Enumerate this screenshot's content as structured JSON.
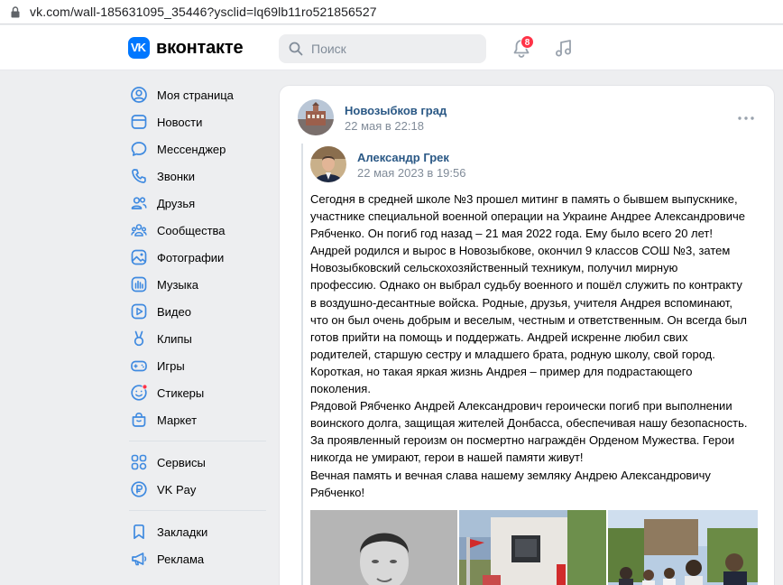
{
  "browser": {
    "url": "vk.com/wall-185631095_35446?ysclid=lq69lb11ro521856527"
  },
  "header": {
    "logo_mark": "VK",
    "logo_text": "вконтакте",
    "search_placeholder": "Поиск",
    "notifications_count": "8",
    "brand_color": "#0077ff",
    "icons": [
      "search-icon",
      "bell-icon",
      "music-icon"
    ]
  },
  "sidebar": {
    "items": [
      {
        "label": "Моя страница",
        "icon": "user-circle-icon"
      },
      {
        "label": "Новости",
        "icon": "news-icon"
      },
      {
        "label": "Мессенджер",
        "icon": "message-icon"
      },
      {
        "label": "Звонки",
        "icon": "phone-icon"
      },
      {
        "label": "Друзья",
        "icon": "friends-icon"
      },
      {
        "label": "Сообщества",
        "icon": "communities-icon"
      },
      {
        "label": "Фотографии",
        "icon": "photo-icon"
      },
      {
        "label": "Музыка",
        "icon": "music-icon"
      },
      {
        "label": "Видео",
        "icon": "video-icon"
      },
      {
        "label": "Клипы",
        "icon": "clips-icon"
      },
      {
        "label": "Игры",
        "icon": "gamepad-icon"
      },
      {
        "label": "Стикеры",
        "icon": "sticker-icon"
      },
      {
        "label": "Маркет",
        "icon": "market-icon"
      }
    ],
    "items2": [
      {
        "label": "Сервисы",
        "icon": "services-icon"
      },
      {
        "label": "VK Pay",
        "icon": "vkpay-icon"
      }
    ],
    "items3": [
      {
        "label": "Закладки",
        "icon": "bookmark-icon"
      },
      {
        "label": "Реклама",
        "icon": "megaphone-icon"
      }
    ]
  },
  "post": {
    "author": "Новозыбков град",
    "date": "22 мая в 22:18",
    "repost": {
      "author": "Александр Грек",
      "date": "22 мая 2023 в 19:56",
      "text_lines": [
        "Сегодня в средней школе №3 прошел митинг в память о бывшем выпускнике,",
        "участнике специальной военной операции на Украине Андрее Александровиче",
        "Рябченко. Он погиб год назад – 21 мая 2022 года. Ему было всего 20 лет!",
        "Андрей родился и вырос в Новозыбкове, окончил 9 классов СОШ №3, затем",
        "Новозыбковский сельскохозяйственный техникум, получил мирную",
        "профессию. Однако он выбрал судьбу военного и пошёл служить по контракту",
        "в воздушно-десантные войска. Родные, друзья, учителя Андрея вспоминают,",
        "что он был очень добрым и веселым, честным и ответственным. Он всегда был",
        "готов прийти на помощь и поддержать. Андрей искренне любил свих",
        "родителей, старшую сестру и младшего брата, родную школу, свой город.",
        "Короткая, но такая яркая жизнь Андрея – пример для подрастающего",
        "поколения.",
        "Рядовой Рябченко Андрей Александрович героически погиб при выполнении",
        "воинского долга, защищая жителей Донбасса, обеспечивая нашу безопасность.",
        "За проявленный героизм он посмертно награждён Орденом Мужества. Герои",
        "никогда не умирают, герои в нашей памяти живут!",
        "Вечная память и вечная слава нашему земляку Андрею Александровичу",
        "Рябченко!"
      ]
    }
  }
}
